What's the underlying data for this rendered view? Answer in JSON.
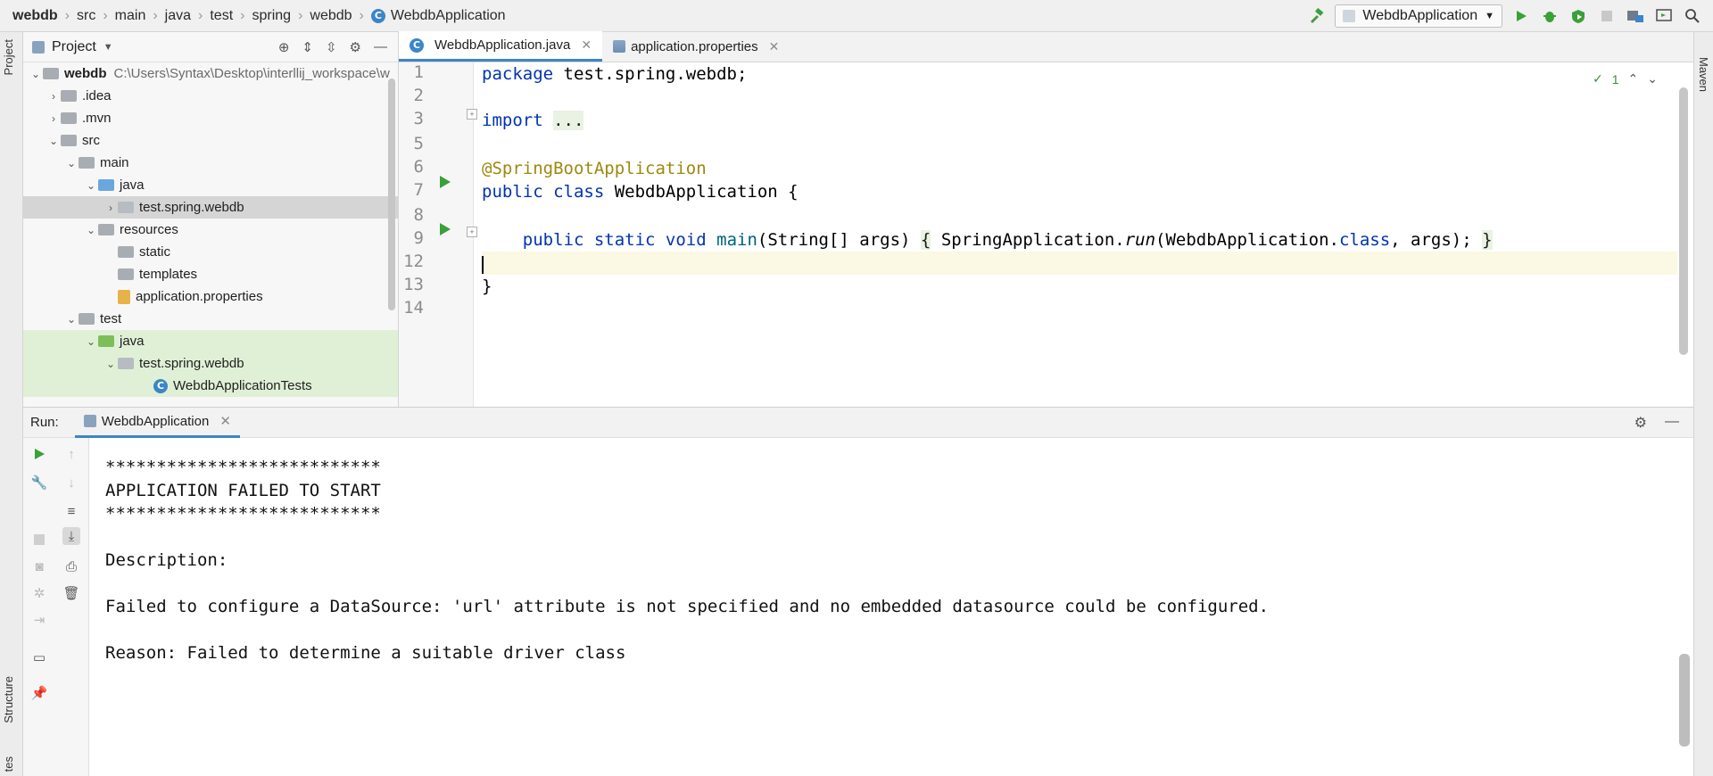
{
  "breadcrumb": [
    "webdb",
    "src",
    "main",
    "java",
    "test",
    "spring",
    "webdb",
    "WebdbApplication"
  ],
  "class_icon_glyph": "C",
  "run_config": {
    "name": "WebdbApplication"
  },
  "left_stripe": {
    "project_label": "Project",
    "structure_label": "Structure",
    "bottom_label": "tes"
  },
  "right_stripe": {
    "maven_label": "Maven"
  },
  "project_panel": {
    "title": "Project",
    "tree": [
      {
        "label": "webdb",
        "extra": "C:\\Users\\Syntax\\Desktop\\interllij_workspace\\w"
      },
      {
        "label": ".idea"
      },
      {
        "label": ".mvn"
      },
      {
        "label": "src"
      },
      {
        "label": "main"
      },
      {
        "label": "java"
      },
      {
        "label": "test.spring.webdb"
      },
      {
        "label": "resources"
      },
      {
        "label": "static"
      },
      {
        "label": "templates"
      },
      {
        "label": "application.properties"
      },
      {
        "label": "test"
      },
      {
        "label": "java"
      },
      {
        "label": "test.spring.webdb"
      },
      {
        "label": "WebdbApplicationTests"
      }
    ]
  },
  "editor": {
    "tabs": [
      {
        "label": "WebdbApplication.java",
        "active": true
      },
      {
        "label": "application.properties",
        "active": false
      }
    ],
    "line_numbers": [
      "1",
      "2",
      "3",
      "5",
      "6",
      "7",
      "8",
      "9",
      "12",
      "13",
      "14"
    ],
    "code": {
      "l1_kw": "package",
      "l1_rest": " test.spring.webdb;",
      "l3_kw": "import",
      "l3_fold": "...",
      "l6_ann": "@SpringBootApplication",
      "l7_kw": "public class",
      "l7_rest": " WebdbApplication {",
      "l9_kw": "public static void",
      "l9_fn": "main",
      "l9_args": "(String[] args) ",
      "l9_open": "{",
      "l9_call": " SpringApplication.",
      "l9_run": "run",
      "l9_arg1": "(WebdbApplication.",
      "l9_class": "class",
      "l9_end": ", args); ",
      "l9_close": "}",
      "l13": "}"
    },
    "inspection_count": "1"
  },
  "run_panel": {
    "label": "Run:",
    "tab": "WebdbApplication",
    "console": [
      "***************************",
      "APPLICATION FAILED TO START",
      "***************************",
      "",
      "Description:",
      "",
      "Failed to configure a DataSource: 'url' attribute is not specified and no embedded datasource could be configured.",
      "",
      "Reason: Failed to determine a suitable driver class"
    ]
  },
  "colors": {
    "keyword": "#0033b3",
    "annotation": "#9e880d",
    "method": "#00627a",
    "run_green": "#3aa03a",
    "accent": "#4083c9"
  }
}
